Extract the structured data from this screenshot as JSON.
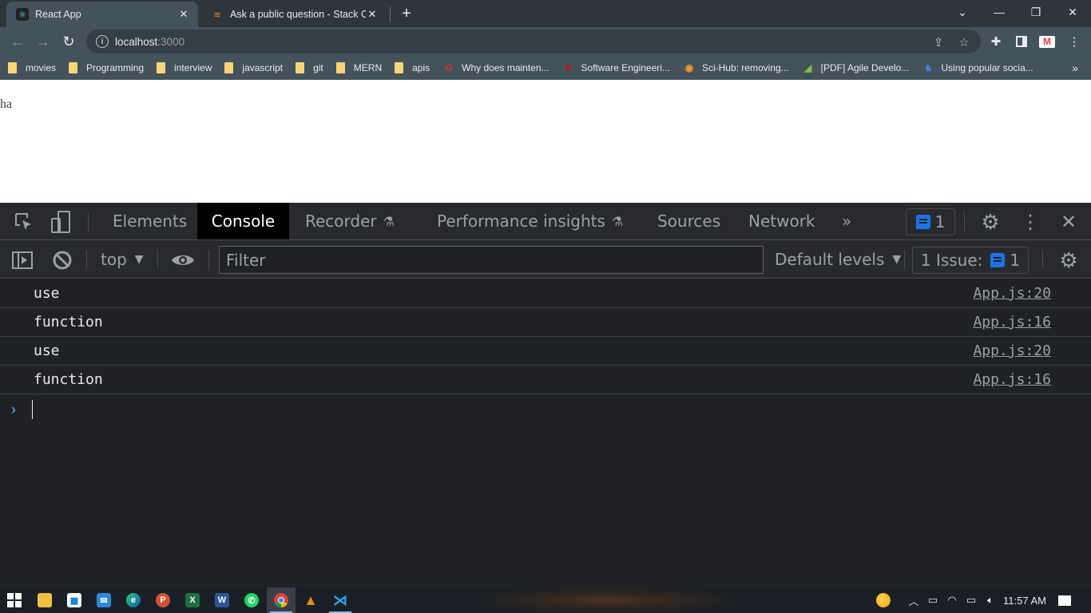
{
  "browser": {
    "tabs": [
      {
        "title": "React App",
        "favicon": "react-icon",
        "active": true
      },
      {
        "title": "Ask a public question - Stack Ove",
        "favicon": "stackoverflow-icon",
        "active": false
      }
    ],
    "new_tab_label": "+",
    "window_controls": {
      "tab_search": "⌄",
      "minimize": "—",
      "restore": "❐",
      "close": "✕"
    },
    "address": {
      "host": "localhost",
      "port": ":3000"
    },
    "bookmarks": [
      {
        "label": "movies",
        "type": "folder"
      },
      {
        "label": "Programming",
        "type": "folder"
      },
      {
        "label": "interview",
        "type": "folder"
      },
      {
        "label": "javascript",
        "type": "folder"
      },
      {
        "label": "git",
        "type": "folder"
      },
      {
        "label": "MERN",
        "type": "folder"
      },
      {
        "label": "apis",
        "type": "folder"
      },
      {
        "label": "Why does mainten...",
        "type": "link",
        "icon": "g-icon"
      },
      {
        "label": "Software Engineeri...",
        "type": "link",
        "icon": "t-icon"
      },
      {
        "label": "Sci-Hub: removing...",
        "type": "link",
        "icon": "scihub-icon"
      },
      {
        "label": "[PDF] Agile Develo...",
        "type": "link",
        "icon": "pdf-icon"
      },
      {
        "label": "Using popular socia...",
        "type": "link",
        "icon": "knight-icon"
      }
    ],
    "bookmarks_more": "»"
  },
  "page": {
    "text": "ha"
  },
  "devtools": {
    "tabs": [
      "Elements",
      "Console",
      "Recorder",
      "Performance insights",
      "Sources",
      "Network"
    ],
    "active_tab": "Console",
    "more_tabs": "»",
    "issues_badge_count": "1",
    "toolbar": {
      "context": "top",
      "filter_placeholder": "Filter",
      "levels": "Default levels",
      "issues_label": "1 Issue:",
      "issues_count": "1"
    },
    "console": {
      "messages": [
        {
          "text": "use",
          "source": "App.js:20"
        },
        {
          "text": "function",
          "source": "App.js:16"
        },
        {
          "text": "use",
          "source": "App.js:20"
        },
        {
          "text": "function",
          "source": "App.js:16"
        }
      ],
      "prompt": "›"
    }
  },
  "taskbar": {
    "apps": [
      "start",
      "file-explorer",
      "store",
      "mail",
      "edge",
      "powerpoint",
      "excel",
      "word",
      "whatsapp",
      "chrome",
      "vlc",
      "vscode"
    ],
    "active_app": "chrome",
    "clock": "11:57 AM"
  }
}
